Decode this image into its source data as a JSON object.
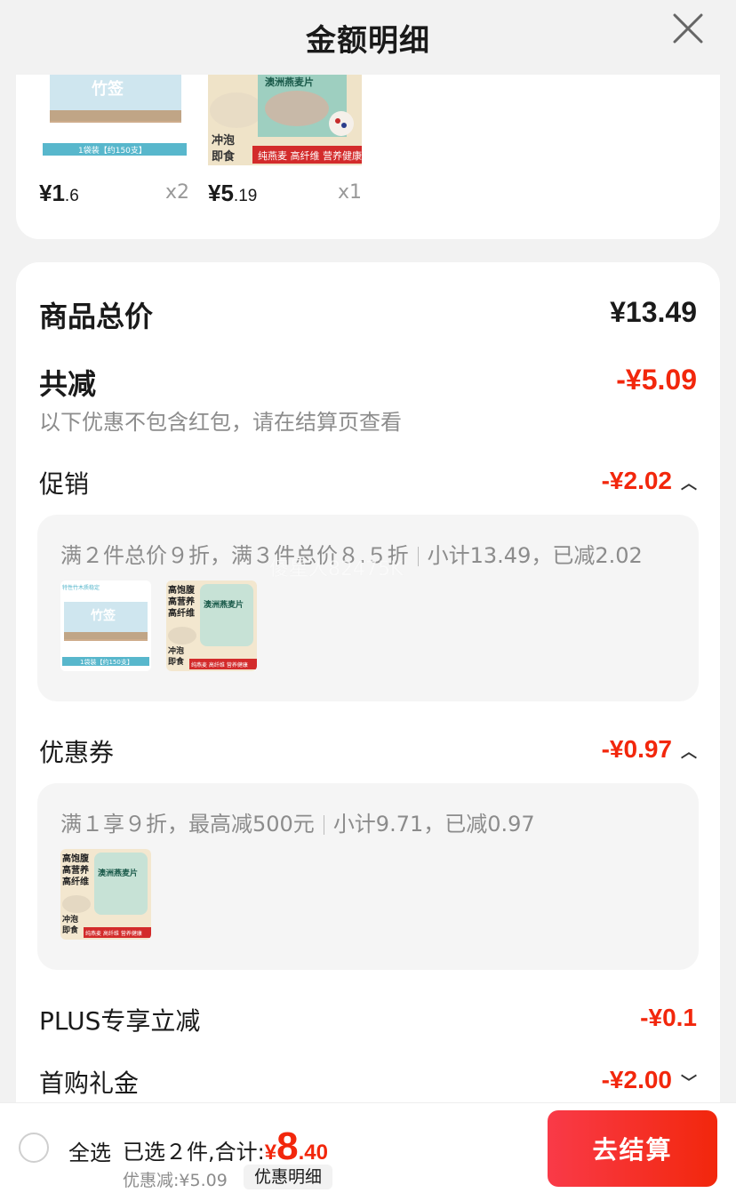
{
  "header": {
    "title": "金额明细"
  },
  "products": [
    {
      "price_int": "¥1",
      "price_dec": ".6",
      "qty": "x2",
      "image": "toothpick-pack",
      "img_caption": "1袋装【约150支】"
    },
    {
      "price_int": "¥5",
      "price_dec": ".19",
      "qty": "x1",
      "image": "oatmeal-bag",
      "img_text": [
        "冲泡",
        "即食"
      ],
      "img_band": "澳洲燕麦片",
      "img_band_sub": "纯燕麦 高纤维 营养健康"
    }
  ],
  "summary": {
    "total_label": "商品总价",
    "total_amount": "¥13.49",
    "reduce_label": "共减",
    "reduce_amount": "-¥5.09",
    "note": "以下优惠不包含红包，请在结算页查看"
  },
  "promotion": {
    "label": "促销",
    "amount": "-¥2.02",
    "rule": "满２件总价９折，满３件总价８.５折",
    "subtotal": "小计13.49，已减2.02",
    "thumbs": [
      "toothpick-pack",
      "oatmeal-jar"
    ]
  },
  "coupon": {
    "label": "优惠券",
    "amount": "-¥0.97",
    "rule": "满１享９折，最高减500元",
    "subtotal": "小计9.71，已减0.97",
    "thumbs": [
      "oatmeal-jar"
    ]
  },
  "plus": {
    "label": "PLUS专享立减",
    "amount": "-¥0.1"
  },
  "first_purchase": {
    "label": "首购礼金",
    "amount": "-¥2.00"
  },
  "watermark": "傻星人82475K",
  "thumb_text": {
    "jar_lines": [
      "高饱腹",
      "高营养",
      "高纤维"
    ],
    "jar_label": "澳洲燕麦片",
    "jar_bottom": [
      "冲泡",
      "即食"
    ],
    "jar_band": "纯燕麦 高纤维 营养健康",
    "pack_caption": "1袋装【约150支】",
    "pack_top": "特性竹木质稳定"
  },
  "bottom_bar": {
    "select_all": "全选",
    "selected_text": "已选２件,合计:",
    "total_symbol": "¥",
    "total_int": "8",
    "total_dec": ".40",
    "discount_text": "优惠减:¥5.09",
    "detail_link": "优惠明细",
    "checkout": "去结算"
  },
  "colors": {
    "accent": "#f2270c",
    "background": "#f2f2f2",
    "card": "#ffffff",
    "muted": "#8c8c8c"
  }
}
